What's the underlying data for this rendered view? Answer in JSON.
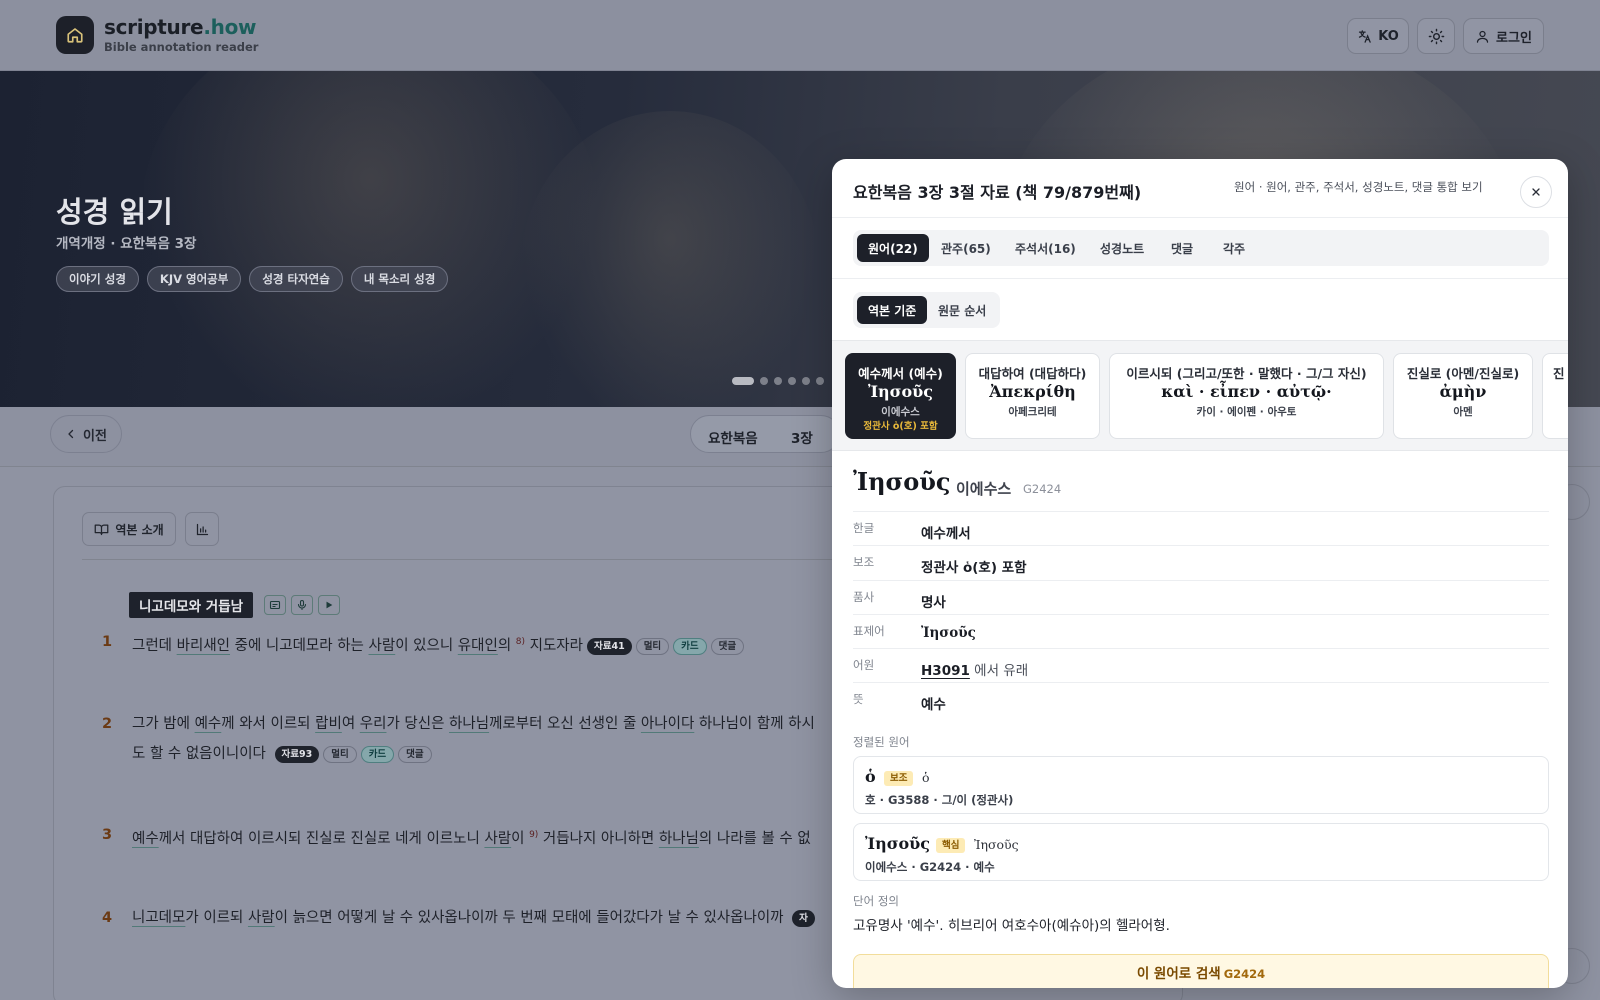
{
  "header": {
    "brand_main": "scripture",
    "brand_tld": ".how",
    "brand_sub": "Bible annotation reader",
    "lang_label": "KO",
    "login_label": "로그인",
    "icons": {
      "home": "home-icon",
      "translate": "translate-icon",
      "theme": "sun-icon",
      "user": "user-icon"
    }
  },
  "hero": {
    "title": "성경 읽기",
    "subtitle": "개역개정 · 요한복음 3장",
    "chips": [
      "이야기 성경",
      "KJV 영어공부",
      "성경 타자연습",
      "내 목소리 성경"
    ],
    "slide_count": 6,
    "active_slide": 1
  },
  "nav": {
    "prev_label": "이전",
    "book": "요한복음",
    "chapter": "3장"
  },
  "reader": {
    "intro_label": "역본 소개",
    "section_title": "니고데모와 거듭남",
    "verses": [
      {
        "num": "1",
        "parts": [
          {
            "t": "그런데 "
          },
          {
            "t": "바리새인",
            "u": true
          },
          {
            "t": " 중에 니고데모라 하는 "
          },
          {
            "t": "사람",
            "u": true
          },
          {
            "t": "이 있으니 "
          },
          {
            "t": "유대인",
            "u": true
          },
          {
            "t": "의 "
          },
          {
            "t": "8)",
            "sup": true
          },
          {
            "t": " 지도자라"
          }
        ],
        "badges": [
          {
            "t": "자료41",
            "k": "dark"
          },
          {
            "t": "멀티",
            "k": "out"
          },
          {
            "t": "카드",
            "k": "teal"
          },
          {
            "t": "댓글",
            "k": "out"
          }
        ]
      },
      {
        "num": "2",
        "parts": [
          {
            "t": "그가 밤에 "
          },
          {
            "t": "예수",
            "u": true
          },
          {
            "t": "께 와서 이르되 "
          },
          {
            "t": "랍비",
            "u": true
          },
          {
            "t": "여 "
          },
          {
            "t": "우리",
            "u": true
          },
          {
            "t": "가 당신은 "
          },
          {
            "t": "하나님",
            "u": true
          },
          {
            "t": "께로부터 오신 선생인 줄 "
          },
          {
            "t": "아나이다",
            "u": true
          },
          {
            "t": " 하나님이 함께 하시"
          }
        ],
        "line2": "도 할 수 없음이니이다",
        "badges": [
          {
            "t": "자료93",
            "k": "dark"
          },
          {
            "t": "멀티",
            "k": "out"
          },
          {
            "t": "카드",
            "k": "teal"
          },
          {
            "t": "댓글",
            "k": "out"
          }
        ]
      },
      {
        "num": "3",
        "parts": [
          {
            "t": "예수",
            "u": true
          },
          {
            "t": "께서 대답하여 이르시되 진실로 진실로 네게 이르노니 "
          },
          {
            "t": "사람",
            "u": true
          },
          {
            "t": "이 "
          },
          {
            "t": "9)",
            "sup": true
          },
          {
            "t": " 거듭나지 아니하면 "
          },
          {
            "t": "하나님",
            "u": true
          },
          {
            "t": "의 나라를 볼 수 없"
          }
        ]
      },
      {
        "num": "4",
        "parts": [
          {
            "t": "니고데모",
            "u": true
          },
          {
            "t": "가 이르되 "
          },
          {
            "t": "사람",
            "u": true
          },
          {
            "t": "이 늙으면 어떻게 날 수 있사옵나이까 두 번째 모태에 들어갔다가 날 수 있사옵나이까 "
          }
        ],
        "badges": [
          {
            "t": "자",
            "k": "dark"
          }
        ]
      }
    ]
  },
  "modal": {
    "title": "요한복음 3장 3절 자료 (책 79/879번째)",
    "hint": "원어 · 원어, 관주, 주석서, 성경노트, 댓글 통합 보기",
    "tabs": [
      "원어(22)",
      "관주(65)",
      "주석서(16)",
      "성경노트",
      "댓글",
      "각주"
    ],
    "active_tab": 0,
    "order_options": [
      "역본 기준",
      "원문 순서"
    ],
    "active_order": 0,
    "word_cards": [
      {
        "ko": "예수께서 (예수)",
        "greek": "Ἰησοῦς",
        "pron": "이에수스",
        "extra": "정관사 ὁ(호) 포함",
        "active": true
      },
      {
        "ko": "대답하여 (대답하다)",
        "greek": "Ἀπεκρίθη",
        "pron": "아페크리테"
      },
      {
        "ko": "이르시되 (그리고/또한 · 말했다 · 그/그 자신)",
        "greek": "καὶ · εἶπεν · αὐτῷ·",
        "pron": "카이 · 에이펜 · 아우토"
      },
      {
        "ko": "진실로 (아멘/진실로)",
        "greek": "ἀμὴν",
        "pron": "아멘"
      },
      {
        "ko": "진",
        "greek": "",
        "pron": ""
      }
    ],
    "detail": {
      "greek": "Ἰησοῦς",
      "pron": "이에수스",
      "strong": "G2424",
      "rows": [
        {
          "k": "한글",
          "v": "예수께서"
        },
        {
          "k": "보조",
          "v": "정관사 ὁ(호) 포함"
        },
        {
          "k": "품사",
          "v": "명사"
        },
        {
          "k": "표제어",
          "v": "Ἰησοῦς"
        },
        {
          "k": "어원",
          "link": "H3091",
          "rest": " 에서 유래"
        },
        {
          "k": "뜻",
          "v": "예수"
        }
      ],
      "aligned_label": "정렬된 원어",
      "aligned": [
        {
          "greek": "ὁ",
          "tag": "보조",
          "greek2": "ὁ",
          "sub": "호 · G3588 · 그/이 (정관사)"
        },
        {
          "greek": "Ἰησοῦς",
          "tag": "핵심",
          "greek2": "Ἰησοῦς",
          "sub": "이에수스 · G2424 · 예수"
        }
      ],
      "definition_label": "단어 정의",
      "definition": "고유명사 '예수'. 히브리어 여호수아(예슈아)의 헬라어형.",
      "search_label": "이 원어로 검색",
      "search_strong": "G2424"
    }
  },
  "colors": {
    "accent_dark": "#1d2029",
    "brand_teal": "#1c5f5c",
    "highlight": "#fff8e3"
  }
}
